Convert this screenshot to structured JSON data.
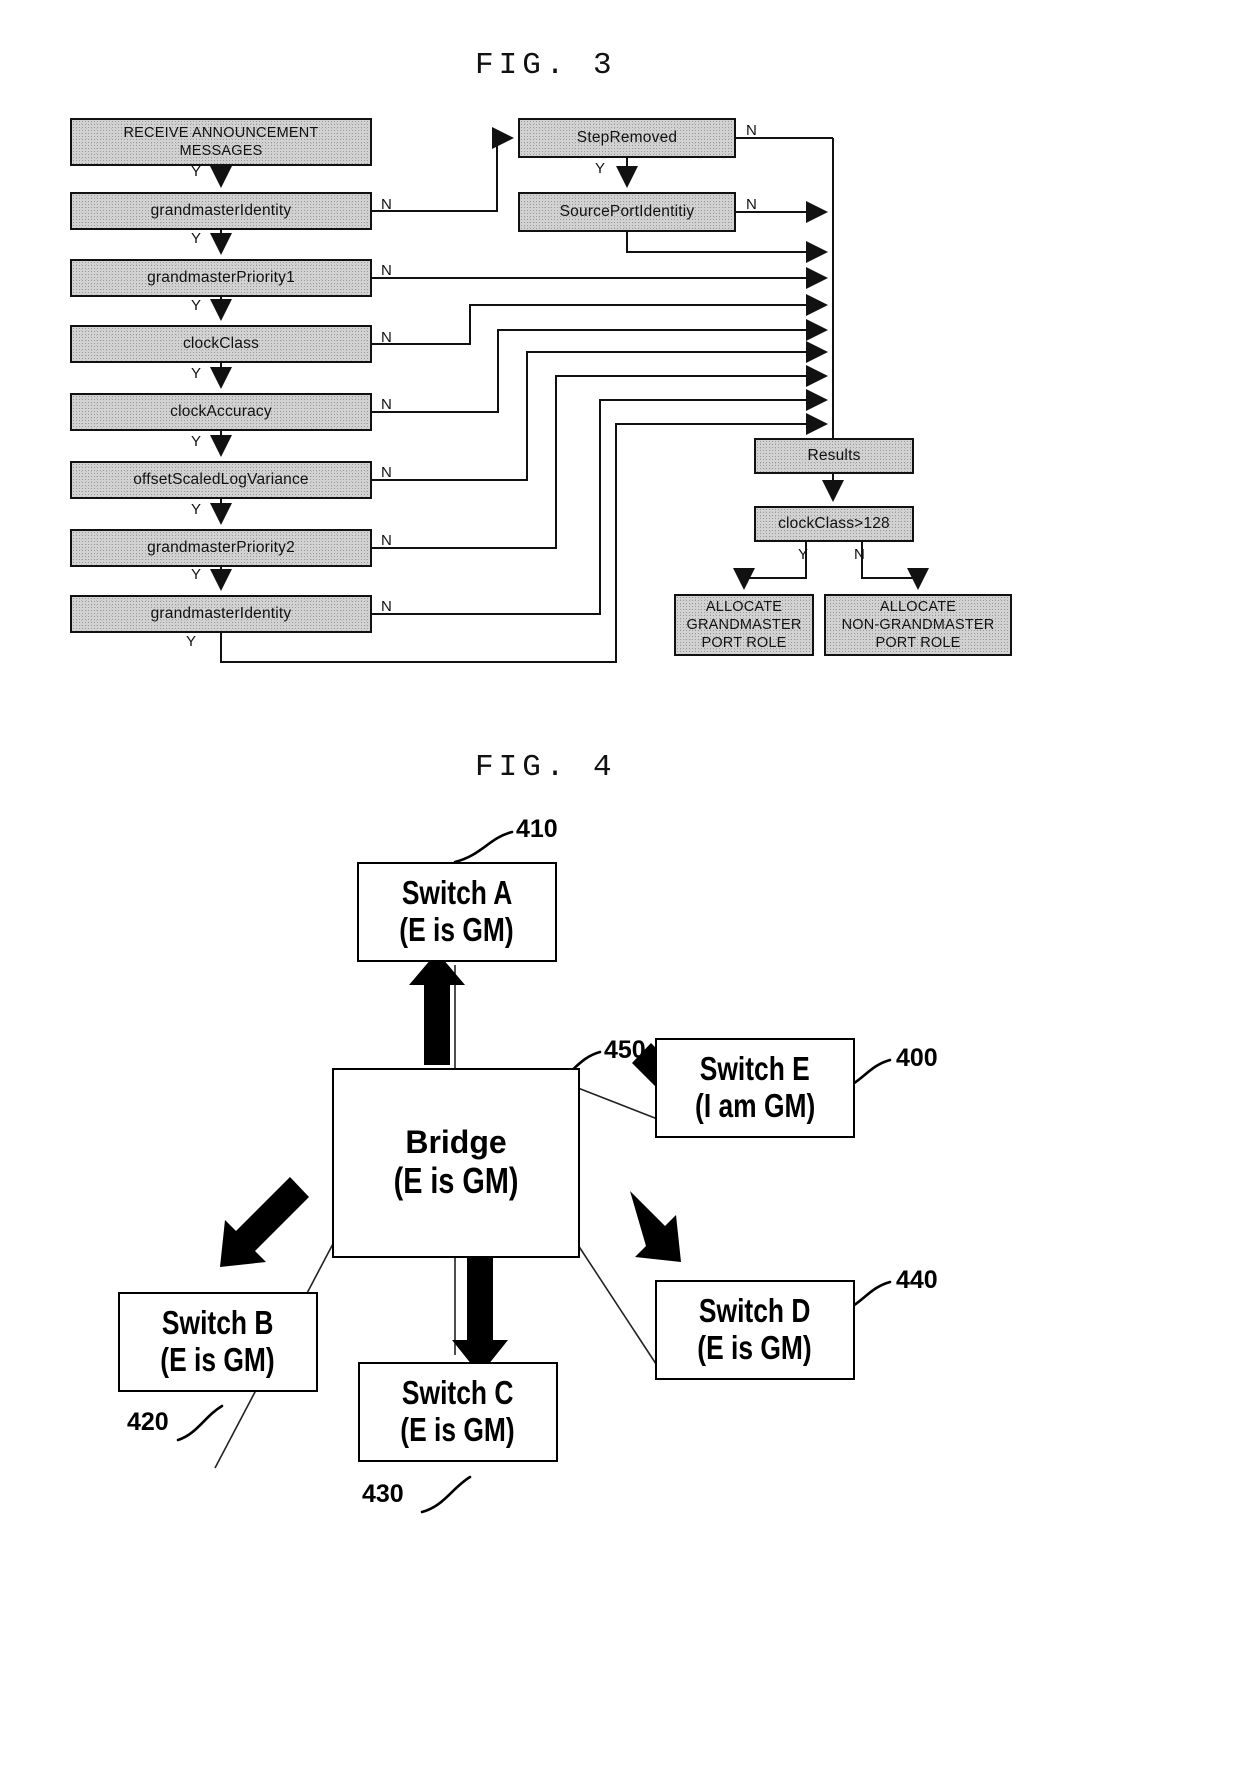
{
  "figures": [
    {
      "id": "fig3",
      "title": "FIG. 3"
    },
    {
      "id": "fig4",
      "title": "FIG. 4"
    }
  ],
  "fig3": {
    "title": "FIG. 3",
    "left_chain": [
      {
        "id": "receive",
        "label": "RECEIVE ANNOUNCEMENT\nMESSAGES",
        "line1": "RECEIVE ANNOUNCEMENT",
        "line2": "MESSAGES",
        "no_label": ""
      },
      {
        "id": "gm-identity-1",
        "label": "grandmasterIdentity",
        "no_label": "N",
        "yes_label": "Y"
      },
      {
        "id": "gm-priority-1",
        "label": "grandmasterPriority1",
        "no_label": "N",
        "yes_label": "Y"
      },
      {
        "id": "clock-class",
        "label": "clockClass",
        "no_label": "N",
        "yes_label": "Y"
      },
      {
        "id": "clock-accuracy",
        "label": "clockAccuracy",
        "no_label": "N",
        "yes_label": "Y"
      },
      {
        "id": "offset-variance",
        "label": "offsetScaledLogVariance",
        "no_label": "N",
        "yes_label": "Y"
      },
      {
        "id": "gm-priority-2",
        "label": "grandmasterPriority2",
        "no_label": "N",
        "yes_label": "Y"
      },
      {
        "id": "gm-identity-2",
        "label": "grandmasterIdentity",
        "no_label": "N",
        "yes_label": "Y"
      }
    ],
    "right_chain": [
      {
        "id": "step-removed",
        "label": "StepRemoved",
        "no_label": "N",
        "yes_label": "Y"
      },
      {
        "id": "source-port",
        "label": "SourcePortIdentitiy",
        "no_label": "N"
      }
    ],
    "results": {
      "label": "Results"
    },
    "decision": {
      "label": "clockClass>128",
      "yes_label": "Y",
      "no_label": "N"
    },
    "outcomes": [
      {
        "id": "allocate-gm",
        "line1": "ALLOCATE",
        "line2": "GRANDMASTER",
        "line3": "PORT ROLE"
      },
      {
        "id": "allocate-nongm",
        "line1": "ALLOCATE",
        "line2": "NON-GRANDMASTER",
        "line3": "PORT ROLE"
      }
    ]
  },
  "fig4": {
    "title": "FIG. 4",
    "nodes": [
      {
        "id": "switch-a",
        "line1": "Switch A",
        "line2": "(E is GM)",
        "ref": "410"
      },
      {
        "id": "bridge",
        "line1": "Bridge",
        "line2": "(E is GM)",
        "ref": "450"
      },
      {
        "id": "switch-e",
        "line1": "Switch E",
        "line2": "(I am GM)",
        "ref": "400"
      },
      {
        "id": "switch-b",
        "line1": "Switch B",
        "line2": "(E is GM)",
        "ref": "420"
      },
      {
        "id": "switch-c",
        "line1": "Switch C",
        "line2": "(E is GM)",
        "ref": "430"
      },
      {
        "id": "switch-d",
        "line1": "Switch D",
        "line2": "(E is GM)",
        "ref": "440"
      }
    ]
  }
}
